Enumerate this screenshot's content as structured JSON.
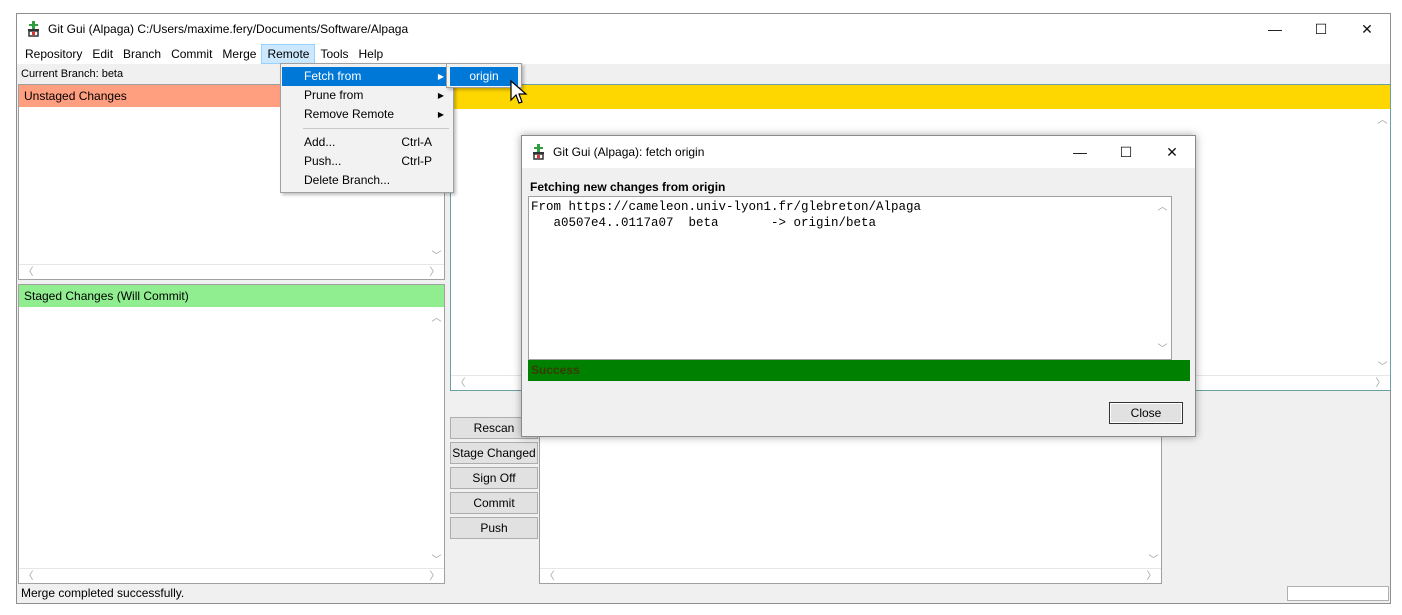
{
  "window": {
    "title": "Git Gui (Alpaga) C:/Users/maxime.fery/Documents/Software/Alpaga",
    "icon": "git-gui-icon",
    "controls": {
      "minimize": "—",
      "maximize": "☐",
      "close": "✕"
    }
  },
  "menubar": {
    "items": [
      "Repository",
      "Edit",
      "Branch",
      "Commit",
      "Merge",
      "Remote",
      "Tools",
      "Help"
    ],
    "active": "Remote"
  },
  "branch": {
    "label": "Current Branch: beta"
  },
  "panes": {
    "unstaged": {
      "title": "Unstaged Changes",
      "color": "#ff9f80"
    },
    "staged": {
      "title": "Staged Changes (Will Commit)",
      "color": "#90ee90"
    },
    "diff_header_color": "#ffd700"
  },
  "buttons": {
    "rescan": "Rescan",
    "stage_changed": "Stage Changed",
    "sign_off": "Sign Off",
    "commit": "Commit",
    "push": "Push"
  },
  "status": {
    "text": "Merge completed successfully."
  },
  "remote_menu": {
    "fetch_from": "Fetch from",
    "prune_from": "Prune from",
    "remove_remote": "Remove Remote",
    "add": "Add...",
    "add_shortcut": "Ctrl-A",
    "push": "Push...",
    "push_shortcut": "Ctrl-P",
    "delete_branch": "Delete Branch..."
  },
  "fetch_submenu": {
    "items": [
      "origin"
    ]
  },
  "dialog": {
    "title": "Git Gui (Alpaga): fetch origin",
    "heading": "Fetching new changes from origin",
    "output_lines": [
      "From https://cameleon.univ-lyon1.fr/glebreton/Alpaga",
      "   a0507e4..0117a07  beta       -> origin/beta"
    ],
    "result": "Success",
    "result_color": "#008000",
    "close_label": "Close"
  }
}
